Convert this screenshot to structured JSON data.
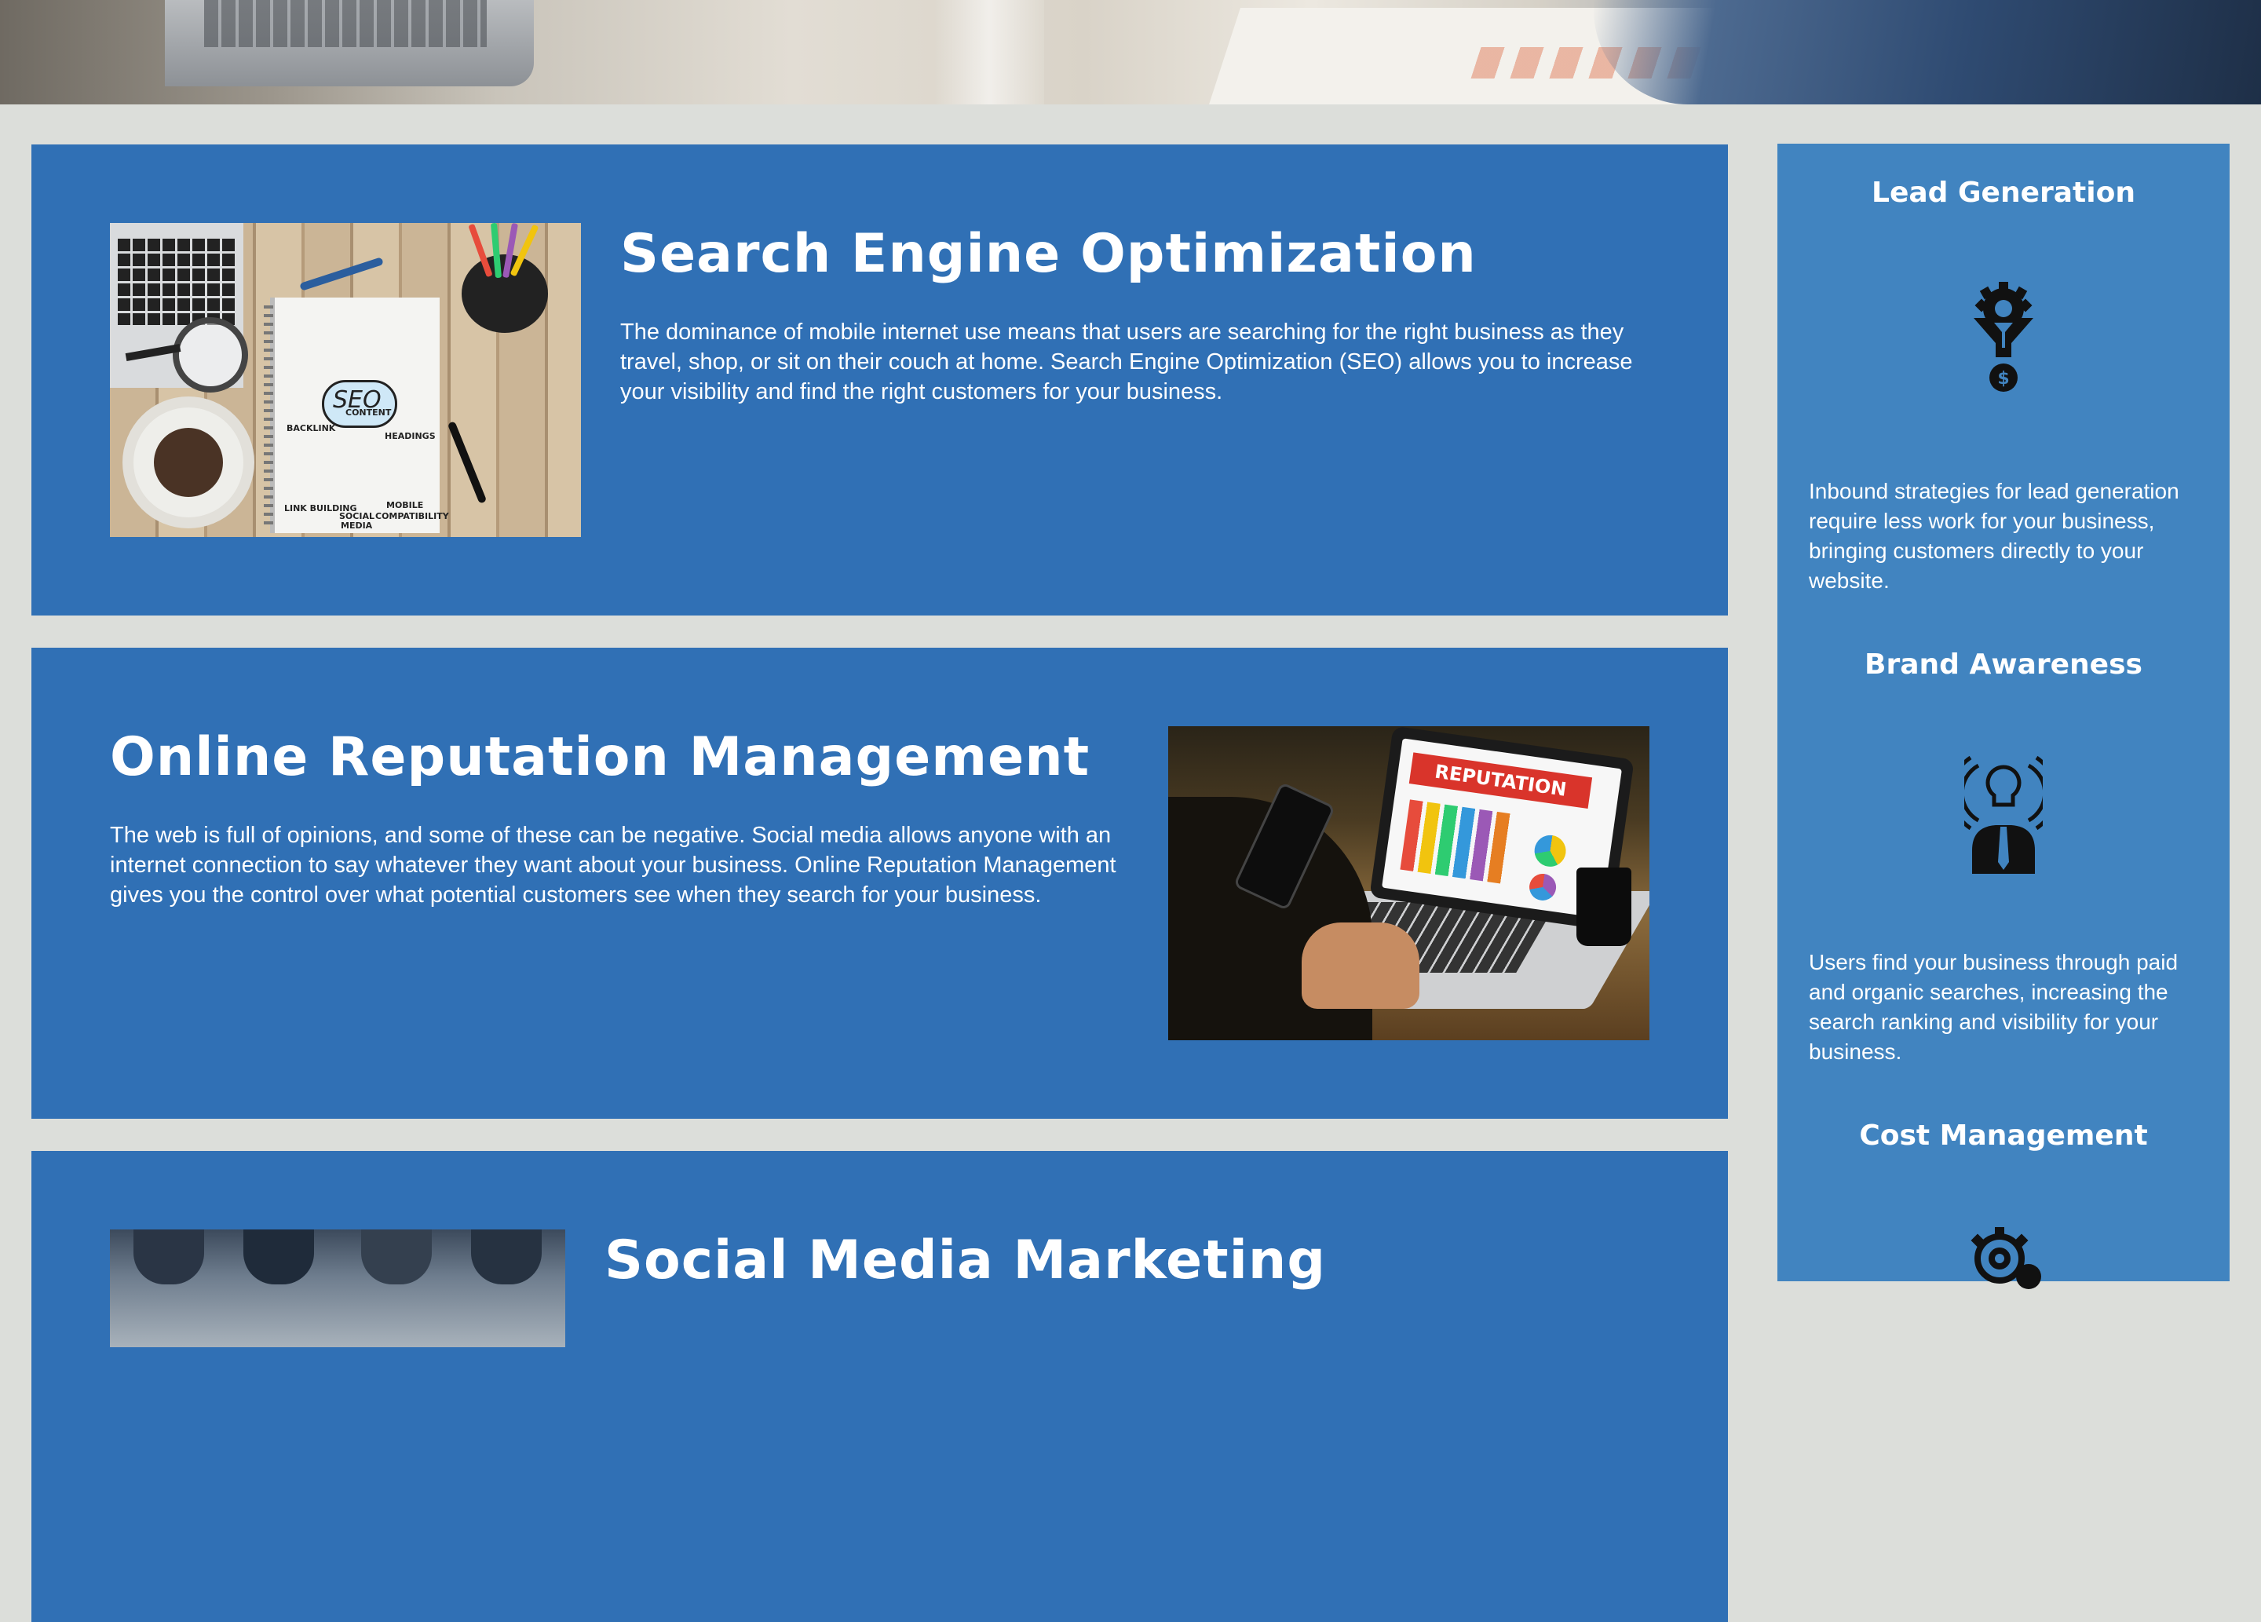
{
  "services": [
    {
      "title": "Search Engine Optimization",
      "body": "The dominance of mobile internet use means that users are searching for the right business as they travel, shop, or sit on their couch at home. Search Engine Optimization (SEO) allows you to increase your visibility and find the right customers for your business.",
      "image_text": {
        "seo": "SEO",
        "content": "CONTENT",
        "backlink": "BACKLINK",
        "headings": "HEADINGS",
        "link_building": "LINK BUILDING",
        "mobile": "MOBILE",
        "compatibility": "COMPATIBILITY",
        "social": "SOCIAL",
        "media": "MEDIA"
      }
    },
    {
      "title": "Online Reputation Management",
      "body": "The web is full of opinions, and some of these can be negative. Social media allows anyone with an internet connection to say whatever they want about your business. Online Reputation Management gives you the control over what potential customers see when they search for your business.",
      "image_text": {
        "banner": "REPUTATION"
      }
    },
    {
      "title": "Social Media Marketing",
      "body": ""
    }
  ],
  "sidebar": {
    "items": [
      {
        "title": "Lead Generation",
        "icon": "funnel-gear-icon",
        "body": "Inbound strategies for lead generation require less work for your business, bringing customers directly to your website."
      },
      {
        "title": "Brand Awareness",
        "icon": "lightbulb-person-icon",
        "body": "Users find your business through paid and organic searches, increasing the search ranking and visibility for your business."
      },
      {
        "title": "Cost Management",
        "icon": "gear-dollar-icon",
        "body": ""
      }
    ]
  },
  "colors": {
    "page_bg": "#dcdeda",
    "card_bg": "#3070b5",
    "sidebar_bg": "#4184c0",
    "text": "#ffffff"
  }
}
